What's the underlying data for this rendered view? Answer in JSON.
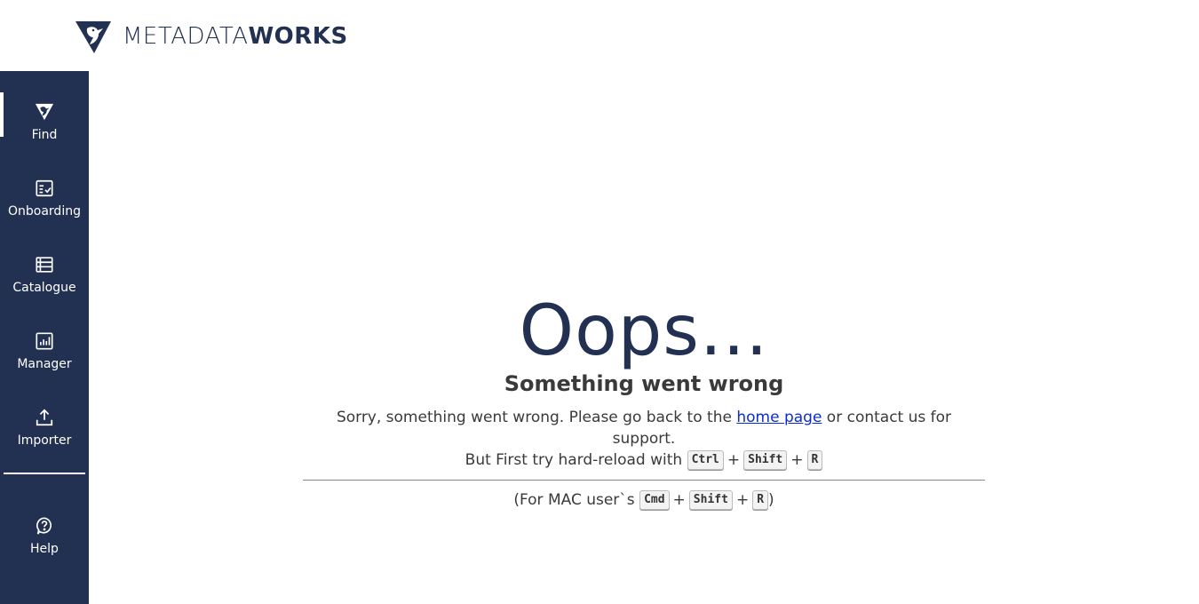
{
  "brand": {
    "name_light": "METADATA",
    "name_bold": "WORKS",
    "color": "#223052"
  },
  "sidebar": {
    "items": [
      {
        "label": "Find",
        "icon": "find-logo-icon",
        "active": true
      },
      {
        "label": "Onboarding",
        "icon": "checklist-icon"
      },
      {
        "label": "Catalogue",
        "icon": "list-icon"
      },
      {
        "label": "Manager",
        "icon": "bar-chart-icon"
      },
      {
        "label": "Importer",
        "icon": "upload-icon"
      },
      {
        "label": "Help",
        "icon": "help-icon"
      }
    ]
  },
  "error": {
    "heading": "Oops...",
    "subtitle": "Something went wrong",
    "message_before": "Sorry, something went wrong. Please go back to the ",
    "link_text": "home page",
    "message_after": " or contact us for support.",
    "reload_text": "But First try hard-reload with",
    "reload_keys": [
      "Ctrl",
      "Shift",
      "R"
    ],
    "plus": "+",
    "mac_prefix": "(For MAC user`s",
    "mac_keys": [
      "Cmd",
      "Shift",
      "R"
    ],
    "mac_suffix": ")"
  },
  "colors": {
    "sidebar_bg": "#223052",
    "link": "#0b2bd4"
  }
}
